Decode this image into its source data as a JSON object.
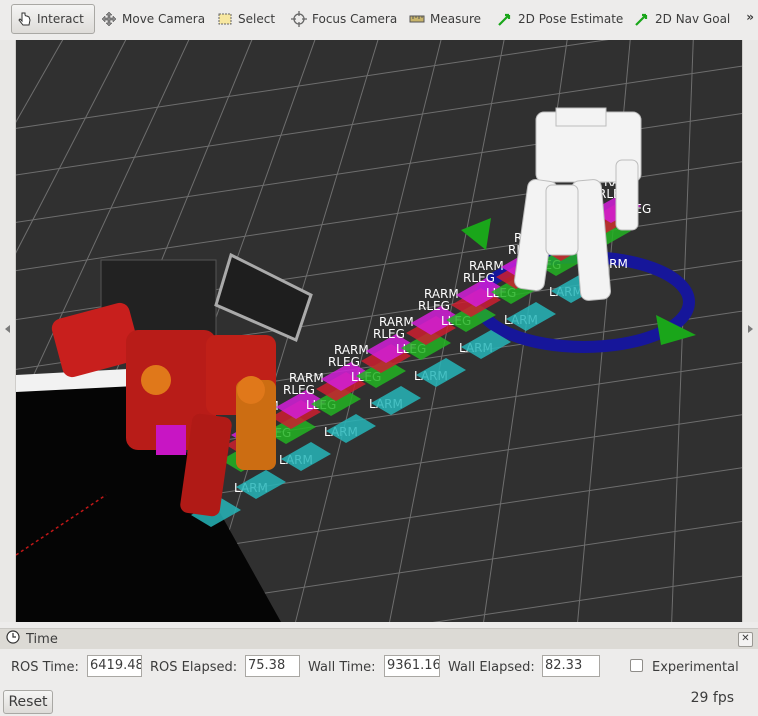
{
  "toolbar": {
    "tools": [
      {
        "label": "Interact",
        "icon": "hand-pointer-icon"
      },
      {
        "label": "Move Camera",
        "icon": "move-arrows-icon"
      },
      {
        "label": "Select",
        "icon": "select-box-icon"
      },
      {
        "label": "Focus Camera",
        "icon": "focus-target-icon"
      },
      {
        "label": "Measure",
        "icon": "ruler-icon"
      },
      {
        "label": "2D Pose Estimate",
        "icon": "green-arrow-icon"
      },
      {
        "label": "2D Nav Goal",
        "icon": "green-arrow-icon"
      }
    ],
    "more": "»"
  },
  "scene": {
    "labels": [
      "RARM",
      "RLEG",
      "LLEG",
      "LARM"
    ]
  },
  "time_panel": {
    "title": "Time",
    "ros_time_label": "ROS Time:",
    "ros_time_value": "6419.48",
    "ros_elapsed_label": "ROS Elapsed:",
    "ros_elapsed_value": "75.38",
    "wall_time_label": "Wall Time:",
    "wall_time_value": "9361.16",
    "wall_elapsed_label": "Wall Elapsed:",
    "wall_elapsed_value": "82.33",
    "experimental_label": "Experimental",
    "experimental_checked": false
  },
  "footer": {
    "reset_label": "Reset",
    "fps": "29 fps"
  },
  "colors": {
    "viewport_bg": "#303030",
    "grid": "#6e6e6e",
    "rarm": "#d21fd8",
    "rleg": "#cc1f2f",
    "lleg": "#22b322",
    "larm": "#26b5b8",
    "robot": "#c8201b"
  }
}
